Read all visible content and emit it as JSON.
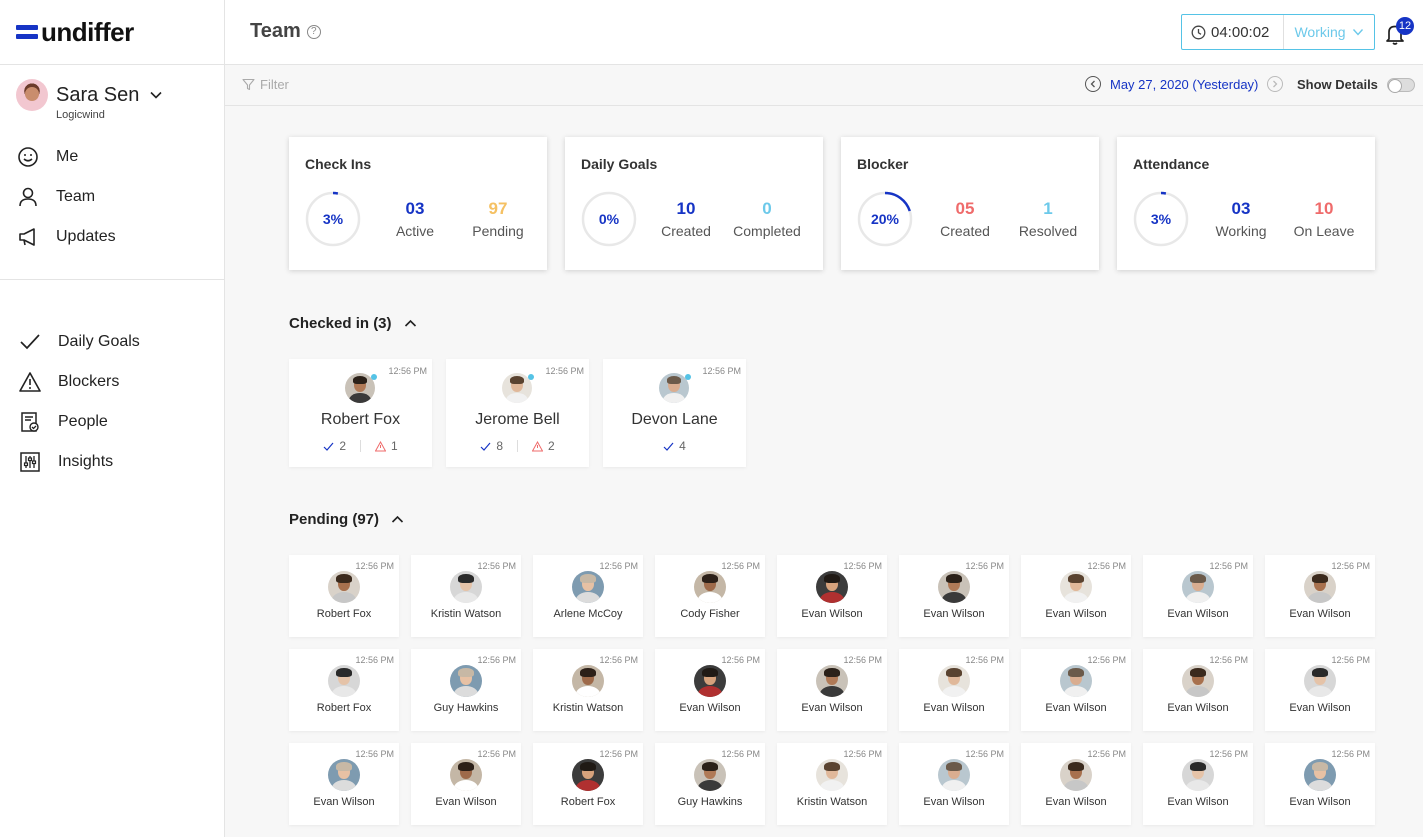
{
  "brand": {
    "name": "undiffer",
    "color": "#1634c5"
  },
  "user": {
    "name": "Sara Sen",
    "org": "Logicwind"
  },
  "nav_primary": [
    {
      "label": "Me",
      "icon": "smile-icon"
    },
    {
      "label": "Team",
      "icon": "user-icon"
    },
    {
      "label": "Updates",
      "icon": "megaphone-icon"
    }
  ],
  "nav_secondary": [
    {
      "label": "Daily Goals",
      "icon": "check-icon"
    },
    {
      "label": "Blockers",
      "icon": "warning-icon"
    },
    {
      "label": "People",
      "icon": "people-doc-icon"
    },
    {
      "label": "Insights",
      "icon": "sliders-icon"
    }
  ],
  "header": {
    "title": "Team",
    "timer": "04:00:02",
    "status": "Working",
    "notifications": "12"
  },
  "toolbar": {
    "filter_placeholder": "Filter",
    "date": "May 27, 2020 (Yesterday)",
    "show_details": "Show Details",
    "show_details_on": false
  },
  "stats": [
    {
      "title": "Check Ins",
      "percent": "3%",
      "progress": 0.03,
      "a": {
        "value": "03",
        "label": "Active",
        "color": "#1634c5"
      },
      "b": {
        "value": "97",
        "label": "Pending",
        "color": "#f5c163"
      }
    },
    {
      "title": "Daily Goals",
      "percent": "0%",
      "progress": 0.0,
      "a": {
        "value": "10",
        "label": "Created",
        "color": "#1634c5"
      },
      "b": {
        "value": "0",
        "label": "Completed",
        "color": "#6cc9ea"
      }
    },
    {
      "title": "Blocker",
      "percent": "20%",
      "progress": 0.2,
      "a": {
        "value": "05",
        "label": "Created",
        "color": "#ef6b6b"
      },
      "b": {
        "value": "1",
        "label": "Resolved",
        "color": "#6cc9ea"
      }
    },
    {
      "title": "Attendance",
      "percent": "3%",
      "progress": 0.03,
      "a": {
        "value": "03",
        "label": "Working",
        "color": "#1634c5"
      },
      "b": {
        "value": "10",
        "label": "On Leave",
        "color": "#ef6b6b"
      }
    }
  ],
  "checked_in": {
    "title": "Checked in (3)",
    "people": [
      {
        "name": "Robert Fox",
        "time": "12:56 PM",
        "goals": "2",
        "blockers": "1"
      },
      {
        "name": "Jerome Bell",
        "time": "12:56 PM",
        "goals": "8",
        "blockers": "2"
      },
      {
        "name": "Devon Lane",
        "time": "12:56 PM",
        "goals": "4",
        "blockers": null
      }
    ]
  },
  "pending": {
    "title": "Pending (97)",
    "people": [
      {
        "name": "Robert Fox",
        "time": "12:56 PM"
      },
      {
        "name": "Kristin Watson",
        "time": "12:56 PM"
      },
      {
        "name": "Arlene McCoy",
        "time": "12:56 PM"
      },
      {
        "name": "Cody Fisher",
        "time": "12:56 PM"
      },
      {
        "name": "Evan Wilson",
        "time": "12:56 PM"
      },
      {
        "name": "Evan Wilson",
        "time": "12:56 PM"
      },
      {
        "name": "Evan Wilson",
        "time": "12:56 PM"
      },
      {
        "name": "Evan Wilson",
        "time": "12:56 PM"
      },
      {
        "name": "Evan Wilson",
        "time": "12:56 PM"
      },
      {
        "name": "Robert Fox",
        "time": "12:56 PM"
      },
      {
        "name": "Guy Hawkins",
        "time": "12:56 PM"
      },
      {
        "name": "Kristin Watson",
        "time": "12:56 PM"
      },
      {
        "name": "Evan Wilson",
        "time": "12:56 PM"
      },
      {
        "name": "Evan Wilson",
        "time": "12:56 PM"
      },
      {
        "name": "Evan Wilson",
        "time": "12:56 PM"
      },
      {
        "name": "Evan Wilson",
        "time": "12:56 PM"
      },
      {
        "name": "Evan Wilson",
        "time": "12:56 PM"
      },
      {
        "name": "Evan Wilson",
        "time": "12:56 PM"
      },
      {
        "name": "Evan Wilson",
        "time": "12:56 PM"
      },
      {
        "name": "Evan Wilson",
        "time": "12:56 PM"
      },
      {
        "name": "Robert Fox",
        "time": "12:56 PM"
      },
      {
        "name": "Guy Hawkins",
        "time": "12:56 PM"
      },
      {
        "name": "Kristin Watson",
        "time": "12:56 PM"
      },
      {
        "name": "Evan Wilson",
        "time": "12:56 PM"
      },
      {
        "name": "Evan Wilson",
        "time": "12:56 PM"
      },
      {
        "name": "Evan Wilson",
        "time": "12:56 PM"
      },
      {
        "name": "Evan Wilson",
        "time": "12:56 PM"
      }
    ]
  },
  "colors": {
    "accent": "#1634c5",
    "cyan": "#55c3e6",
    "ring_track": "#e8e8e8"
  }
}
